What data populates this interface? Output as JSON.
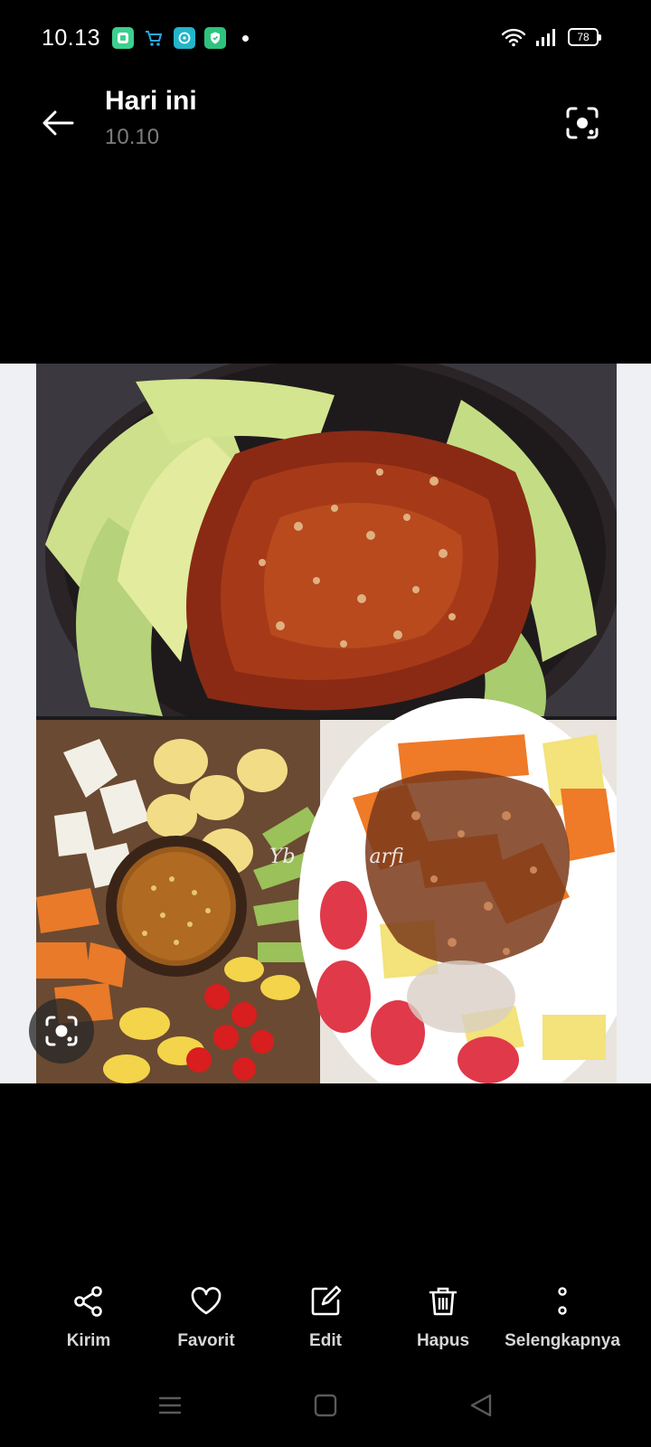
{
  "status_bar": {
    "time": "10.13",
    "battery_level": "78",
    "notification_icons": [
      "app-icon",
      "shop-icon",
      "chat-icon",
      "shield-icon"
    ],
    "system_icons": [
      "wifi-icon",
      "signal-icon",
      "battery-icon"
    ]
  },
  "header": {
    "title": "Hari ini",
    "subtitle": "10.10"
  },
  "photo": {
    "watermark": "Yb mama arfi"
  },
  "actions": {
    "share_label": "Kirim",
    "favorite_label": "Favorit",
    "edit_label": "Edit",
    "delete_label": "Hapus",
    "more_label": "Selengkapnya"
  },
  "colors": {
    "background": "#000000",
    "subtitle": "#7c7c7c",
    "action_label": "#d6d6d6",
    "photo_frame": "#eef0f3"
  }
}
